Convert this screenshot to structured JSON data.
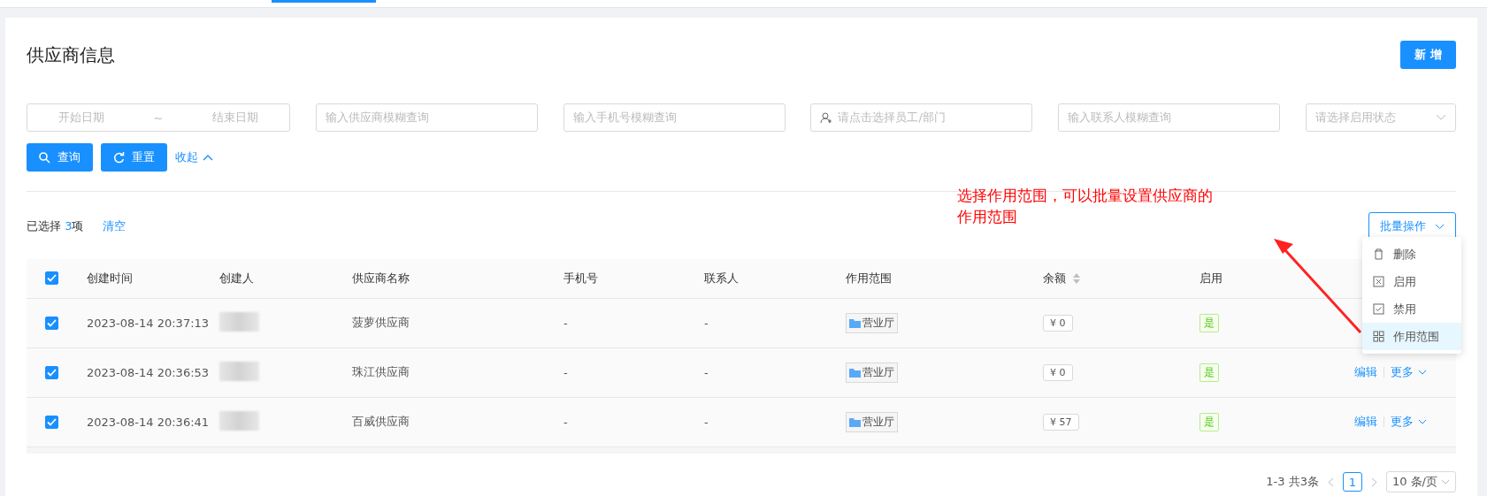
{
  "page_title": "供应商信息",
  "add_button": "新 增",
  "filters": [
    {
      "kind": "daterange",
      "start": "开始日期",
      "sep": "~",
      "end": "结束日期"
    },
    {
      "kind": "text",
      "placeholder": "输入供应商模糊查询"
    },
    {
      "kind": "text",
      "placeholder": "输入手机号模糊查询"
    },
    {
      "kind": "picker",
      "placeholder": "请点击选择员工/部门"
    },
    {
      "kind": "text",
      "placeholder": "输入联系人模糊查询"
    },
    {
      "kind": "select",
      "placeholder": "请选择启用状态"
    }
  ],
  "search_button": "查询",
  "reset_button": "重置",
  "collapse_link": "收起",
  "selection": {
    "prefix": "已选择 ",
    "count": "3",
    "suffix": "项",
    "clear": "清空"
  },
  "batch_button": "批量操作",
  "annotation": "选择作用范围，可以批量设置供应商的作用范围",
  "batch_menu": [
    {
      "kind": "delete",
      "label": "删除",
      "selected": false
    },
    {
      "kind": "enable",
      "label": "启用",
      "selected": false
    },
    {
      "kind": "disable",
      "label": "禁用",
      "selected": false
    },
    {
      "kind": "scope",
      "label": "作用范围",
      "selected": true
    }
  ],
  "table": {
    "all_checked": true,
    "columns": [
      "创建时间",
      "创建人",
      "供应商名称",
      "手机号",
      "联系人",
      "作用范围",
      "余额",
      "启用"
    ],
    "rows": [
      {
        "checked": true,
        "created": "2023-08-14 20:37:13",
        "name": "菠萝供应商",
        "phone": "-",
        "contact": "-",
        "scope": "营业厅",
        "balance": "¥ 0",
        "enabled": "是"
      },
      {
        "checked": true,
        "created": "2023-08-14 20:36:53",
        "name": "珠江供应商",
        "phone": "-",
        "contact": "-",
        "scope": "营业厅",
        "balance": "¥ 0",
        "enabled": "是",
        "actions": [
          "编辑",
          "更多"
        ]
      },
      {
        "checked": true,
        "created": "2023-08-14 20:36:41",
        "name": "百威供应商",
        "phone": "-",
        "contact": "-",
        "scope": "营业厅",
        "balance": "¥ 57",
        "enabled": "是",
        "actions": [
          "编辑",
          "更多"
        ]
      }
    ]
  },
  "pagination": {
    "total": "1-3 共3条",
    "pages": [
      {
        "label": "1",
        "selected": true
      }
    ],
    "page_size": "10 条/页"
  }
}
